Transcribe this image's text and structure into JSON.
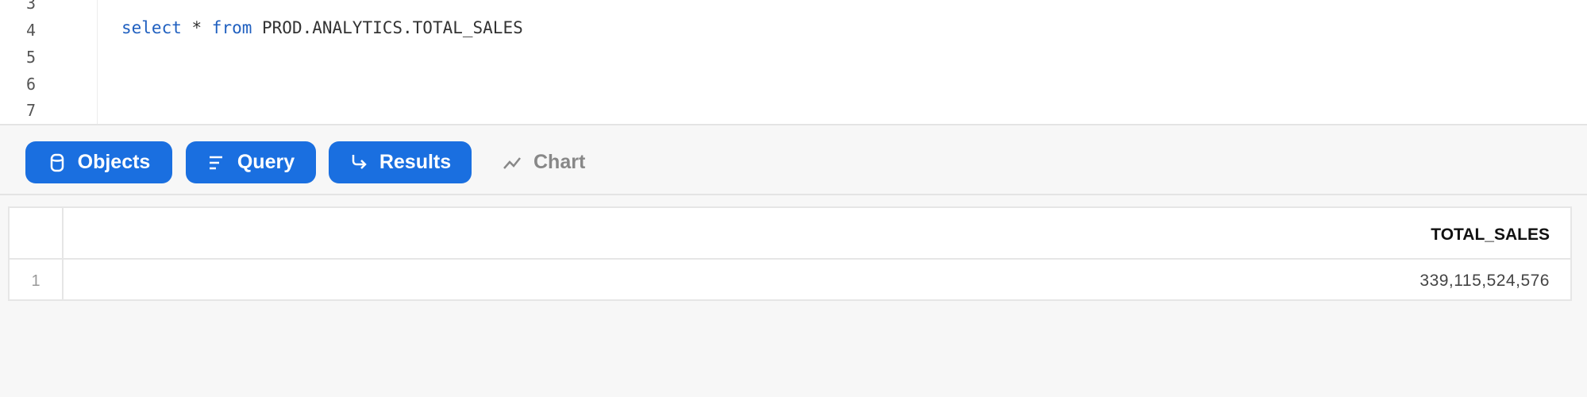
{
  "editor": {
    "line_numbers": [
      "3",
      "4",
      "5",
      "6",
      "7"
    ],
    "code": {
      "kw1": "select",
      "op": " * ",
      "kw2": "from",
      "rest": " PROD.ANALYTICS.TOTAL_SALES"
    }
  },
  "toolbar": {
    "objects_label": "Objects",
    "query_label": "Query",
    "results_label": "Results",
    "chart_label": "Chart",
    "accent": "#1a6fe0"
  },
  "results": {
    "columns": [
      "TOTAL_SALES"
    ],
    "rows": [
      {
        "num": "1",
        "values": [
          "339,115,524,576"
        ]
      }
    ]
  }
}
